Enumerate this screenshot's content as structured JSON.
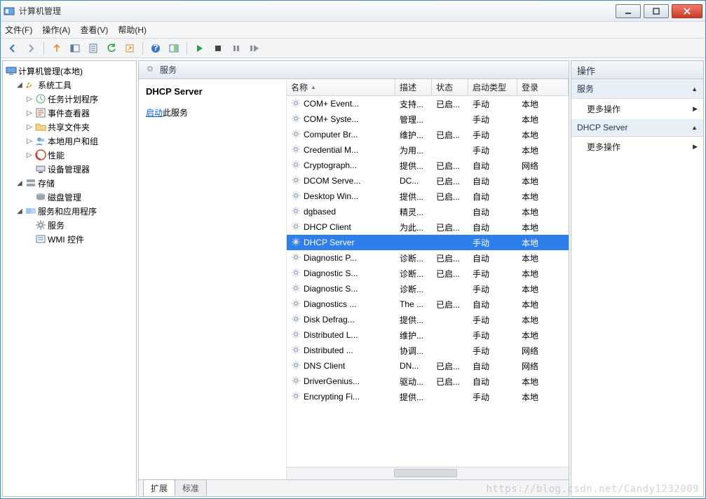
{
  "window": {
    "title": "计算机管理"
  },
  "menu": {
    "file": "文件(F)",
    "action": "操作(A)",
    "view": "查看(V)",
    "help": "帮助(H)"
  },
  "tree": {
    "root": "计算机管理(本地)",
    "system_tools": "系统工具",
    "task_scheduler": "任务计划程序",
    "event_viewer": "事件查看器",
    "shared_folders": "共享文件夹",
    "local_users": "本地用户和组",
    "performance": "性能",
    "device_mgr": "设备管理器",
    "storage": "存储",
    "disk_mgmt": "磁盘管理",
    "services_apps": "服务和应用程序",
    "services": "服务",
    "wmi": "WMI 控件"
  },
  "center": {
    "header": "服务",
    "selected_name": "DHCP Server",
    "start_link": "启动",
    "start_suffix": "此服务",
    "tabs": {
      "extended": "扩展",
      "standard": "标准"
    },
    "columns": {
      "name": "名称",
      "desc": "描述",
      "status": "状态",
      "startup": "启动类型",
      "logon": "登录"
    }
  },
  "services": [
    {
      "name": "COM+ Event...",
      "desc": "支持...",
      "status": "已启...",
      "startup": "手动",
      "logon": "本地"
    },
    {
      "name": "COM+ Syste...",
      "desc": "管理...",
      "status": "",
      "startup": "手动",
      "logon": "本地"
    },
    {
      "name": "Computer Br...",
      "desc": "维护...",
      "status": "已启...",
      "startup": "手动",
      "logon": "本地"
    },
    {
      "name": "Credential M...",
      "desc": "为用...",
      "status": "",
      "startup": "手动",
      "logon": "本地"
    },
    {
      "name": "Cryptograph...",
      "desc": "提供...",
      "status": "已启...",
      "startup": "自动",
      "logon": "网络"
    },
    {
      "name": "DCOM Serve...",
      "desc": "DC...",
      "status": "已启...",
      "startup": "自动",
      "logon": "本地"
    },
    {
      "name": "Desktop Win...",
      "desc": "提供...",
      "status": "已启...",
      "startup": "自动",
      "logon": "本地"
    },
    {
      "name": "dgbased",
      "desc": "精灵...",
      "status": "",
      "startup": "自动",
      "logon": "本地"
    },
    {
      "name": "DHCP Client",
      "desc": "为此...",
      "status": "已启...",
      "startup": "自动",
      "logon": "本地"
    },
    {
      "name": "DHCP Server",
      "desc": "",
      "status": "",
      "startup": "手动",
      "logon": "本地",
      "selected": true
    },
    {
      "name": "Diagnostic P...",
      "desc": "诊断...",
      "status": "已启...",
      "startup": "自动",
      "logon": "本地"
    },
    {
      "name": "Diagnostic S...",
      "desc": "诊断...",
      "status": "已启...",
      "startup": "手动",
      "logon": "本地"
    },
    {
      "name": "Diagnostic S...",
      "desc": "诊断...",
      "status": "",
      "startup": "手动",
      "logon": "本地"
    },
    {
      "name": "Diagnostics ...",
      "desc": "The ...",
      "status": "已启...",
      "startup": "自动",
      "logon": "本地"
    },
    {
      "name": "Disk Defrag...",
      "desc": "提供...",
      "status": "",
      "startup": "手动",
      "logon": "本地"
    },
    {
      "name": "Distributed L...",
      "desc": "维护...",
      "status": "",
      "startup": "手动",
      "logon": "本地"
    },
    {
      "name": "Distributed ...",
      "desc": "协调...",
      "status": "",
      "startup": "手动",
      "logon": "网络"
    },
    {
      "name": "DNS Client",
      "desc": "DN...",
      "status": "已启...",
      "startup": "自动",
      "logon": "网络"
    },
    {
      "name": "DriverGenius...",
      "desc": "驱动...",
      "status": "已启...",
      "startup": "自动",
      "logon": "本地"
    },
    {
      "name": "Encrypting Fi...",
      "desc": "提供...",
      "status": "",
      "startup": "手动",
      "logon": "本地"
    }
  ],
  "actions": {
    "header": "操作",
    "group1": "服务",
    "more": "更多操作",
    "group2": "DHCP Server"
  },
  "watermark": "https://blog.csdn.net/Candy1232009"
}
